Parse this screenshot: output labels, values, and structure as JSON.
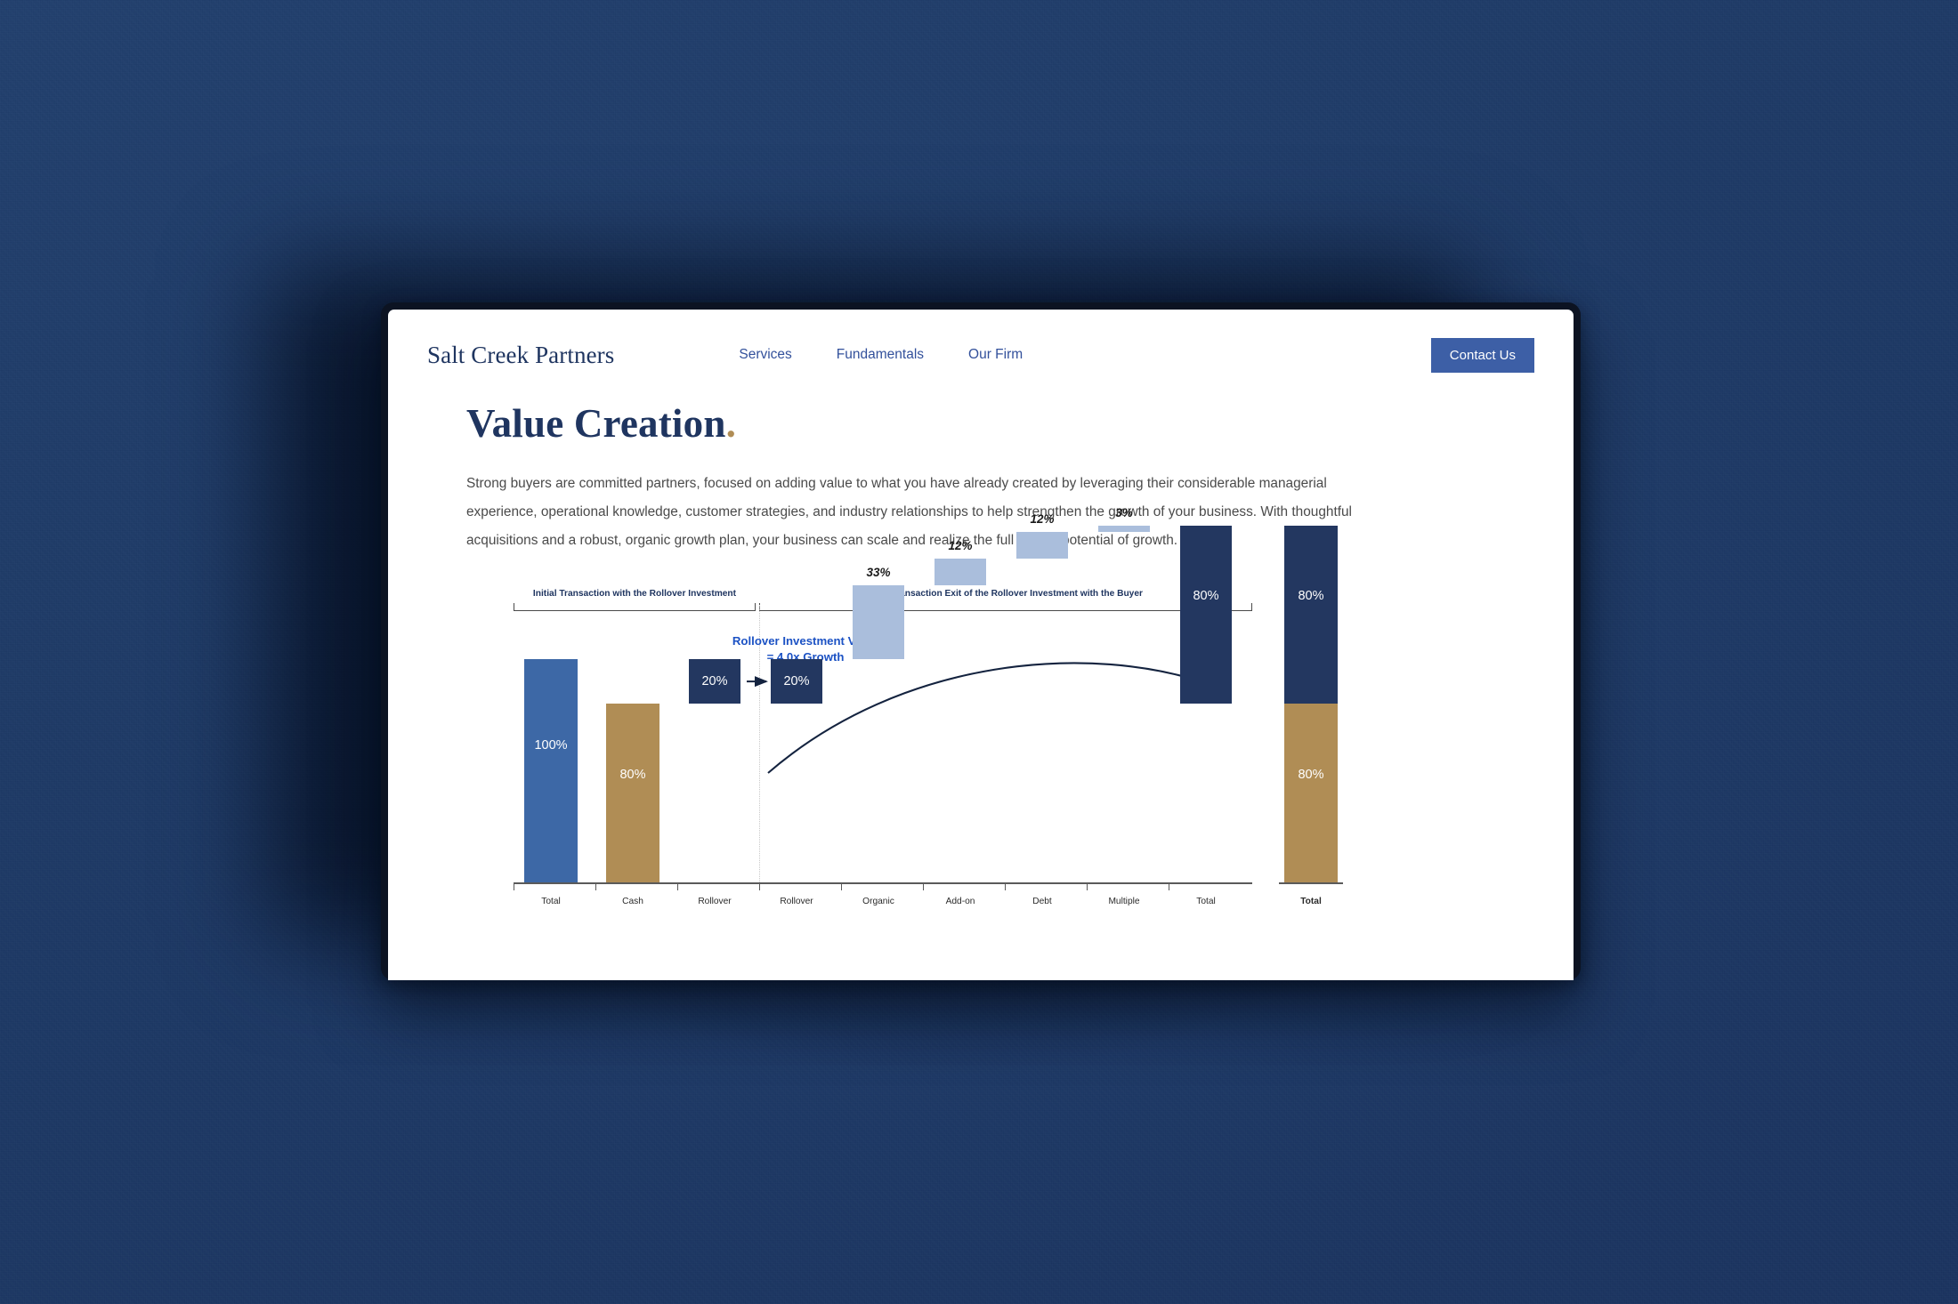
{
  "site": {
    "brand": "Salt Creek Partners",
    "nav": [
      {
        "label": "Services"
      },
      {
        "label": "Fundamentals"
      },
      {
        "label": "Our Firm"
      }
    ],
    "contact_button": "Contact Us"
  },
  "page": {
    "title": "Value Creation",
    "title_dot": ".",
    "intro": "Strong buyers are committed partners, focused on adding value to what you have already created by leveraging their considerable managerial experience, operational knowledge, customer strategies, and industry relationships to help strengthen the growth of your business. With thoughtful acquisitions and a robust, organic growth plan, your business can scale and realize the full upside potential of growth."
  },
  "colors": {
    "backdrop": "#1e3a66",
    "navy": "#233760",
    "blue": "#3d68a6",
    "gold": "#b08d55",
    "light_blue": "#aabedc",
    "accent_link": "#32509b",
    "button": "#3d5fa6",
    "annotation": "#1c52c4"
  },
  "chart_data": {
    "type": "bar",
    "title": "",
    "xlabel": "",
    "ylabel": "",
    "ylim": [
      0,
      110
    ],
    "grid": false,
    "legend": false,
    "phases": [
      {
        "label": "Initial Transaction with the Rollover Investment",
        "from": 0,
        "to": 2
      },
      {
        "label": "Post-Transaction Exit of the Rollover Investment with the Buyer",
        "from": 3,
        "to": 9
      }
    ],
    "annotation": {
      "line1": "Rollover Investment Value",
      "line2": "= 4.0x Growth"
    },
    "categories": [
      "Total",
      "Cash",
      "Rollover",
      "Rollover",
      "Organic",
      "Add-on",
      "Debt",
      "Multiple",
      "Total",
      "Total"
    ],
    "bars": [
      {
        "category": "Total",
        "label": "100%",
        "value": 100,
        "base": 0,
        "kind": "column",
        "color": "blue",
        "label_inside": true,
        "bold_axis": false
      },
      {
        "category": "Cash",
        "label": "80%",
        "value": 80,
        "base": 0,
        "kind": "column",
        "color": "gold",
        "label_inside": true,
        "bold_axis": false
      },
      {
        "category": "Rollover",
        "label": "20%",
        "value": 20,
        "base": 80,
        "kind": "float",
        "color": "navy",
        "label_inside": true,
        "bold_axis": false
      },
      {
        "category": "Rollover",
        "label": "20%",
        "value": 20,
        "base": 80,
        "kind": "float",
        "color": "navy",
        "label_inside": true,
        "bold_axis": false
      },
      {
        "category": "Organic",
        "label": "33%",
        "value": 33,
        "base": 100,
        "kind": "float",
        "color": "light",
        "label_inside": false,
        "bold_axis": false
      },
      {
        "category": "Add-on",
        "label": "12%",
        "value": 12,
        "base": 133,
        "kind": "float",
        "color": "light",
        "label_inside": false,
        "bold_axis": false
      },
      {
        "category": "Debt",
        "label": "12%",
        "value": 12,
        "base": 145,
        "kind": "float",
        "color": "light",
        "label_inside": false,
        "bold_axis": false
      },
      {
        "category": "Multiple",
        "label": "3%",
        "value": 3,
        "base": 157,
        "kind": "float",
        "color": "light",
        "label_inside": false,
        "bold_axis": false
      },
      {
        "category": "Total",
        "label": "80%",
        "value": 80,
        "base": 80,
        "kind": "float",
        "color": "navy",
        "label_inside": true,
        "bold_axis": false
      },
      {
        "category": "Total",
        "label": "80%",
        "value": 80,
        "base": 80,
        "kind": "stacked",
        "color": "navy",
        "label_inside": true,
        "bold_axis": true
      },
      {
        "category": "Total",
        "label": "80%",
        "value": 80,
        "base": 0,
        "kind": "stacked",
        "color": "gold",
        "label_inside": true,
        "bold_axis": true
      }
    ]
  }
}
